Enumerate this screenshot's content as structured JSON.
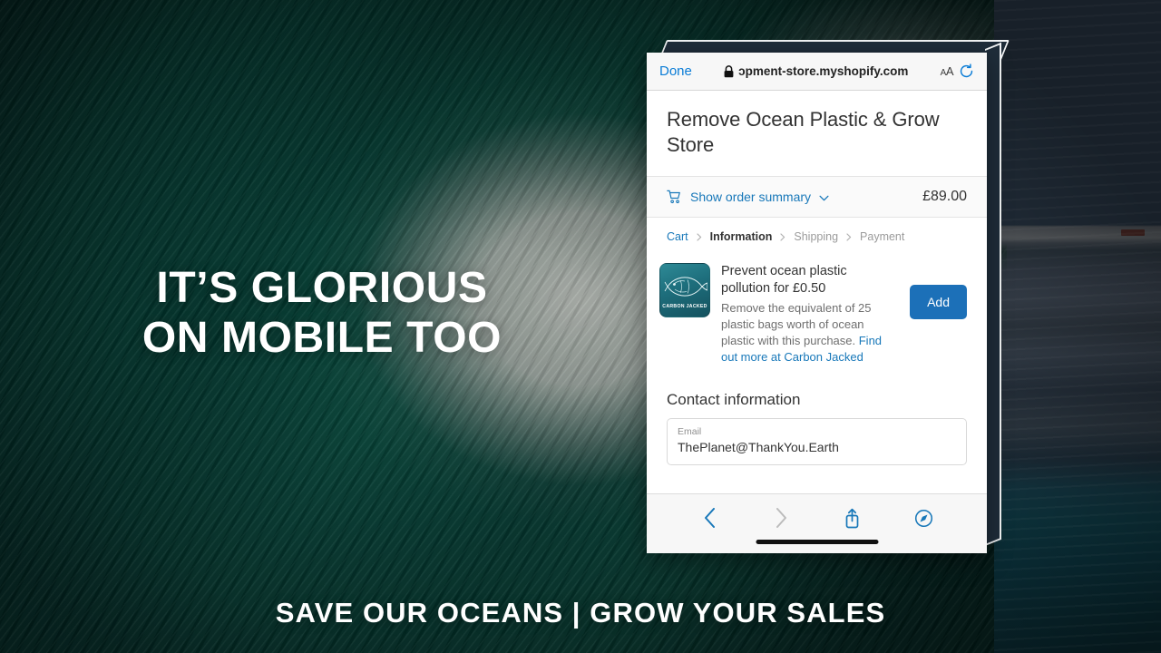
{
  "promo": {
    "headline_line1": "IT’S GLORIOUS",
    "headline_line2": "ON MOBILE TOO",
    "footer_tagline": "SAVE OUR OCEANS | GROW YOUR SALES",
    "background_colors": {
      "wave_green": "#044539",
      "frame_navy": "#2c3b4b",
      "ocean_blue": "#123f4d"
    }
  },
  "browser": {
    "done_label": "Done",
    "url": "ɔpment-store.myshopify.com",
    "lock_icon": "lock-icon",
    "text_size_label": "AA",
    "reload_icon": "reload-icon",
    "back_icon": "chevron-left-icon",
    "forward_icon": "chevron-right-icon",
    "share_icon": "share-icon",
    "tabs_icon": "safari-compass-icon"
  },
  "checkout": {
    "store_title": "Remove Ocean Plastic & Grow Store",
    "summary": {
      "cart_icon": "cart-icon",
      "toggle_label": "Show order summary",
      "chevron_icon": "chevron-down-icon",
      "total": "£89.00"
    },
    "breadcrumb": [
      {
        "label": "Cart",
        "state": "link"
      },
      {
        "label": "Information",
        "state": "current"
      },
      {
        "label": "Shipping",
        "state": "upcoming"
      },
      {
        "label": "Payment",
        "state": "upcoming"
      }
    ],
    "offer": {
      "thumbnail_alt": "carbon-jacked-fish-thumbnail",
      "thumbnail_brand": "CARBON JACKED",
      "title": "Prevent ocean plastic pollution for £0.50",
      "description": "Remove the equivalent of 25 plastic bags worth of ocean plastic with this purchase. ",
      "link_text": "Find out more at Carbon Jacked",
      "add_label": "Add",
      "accent_color": "#1c70b8"
    },
    "contact": {
      "heading": "Contact information",
      "email_label": "Email",
      "email_value": "ThePlanet@ThankYou.Earth",
      "email_placeholder": "Email"
    }
  }
}
